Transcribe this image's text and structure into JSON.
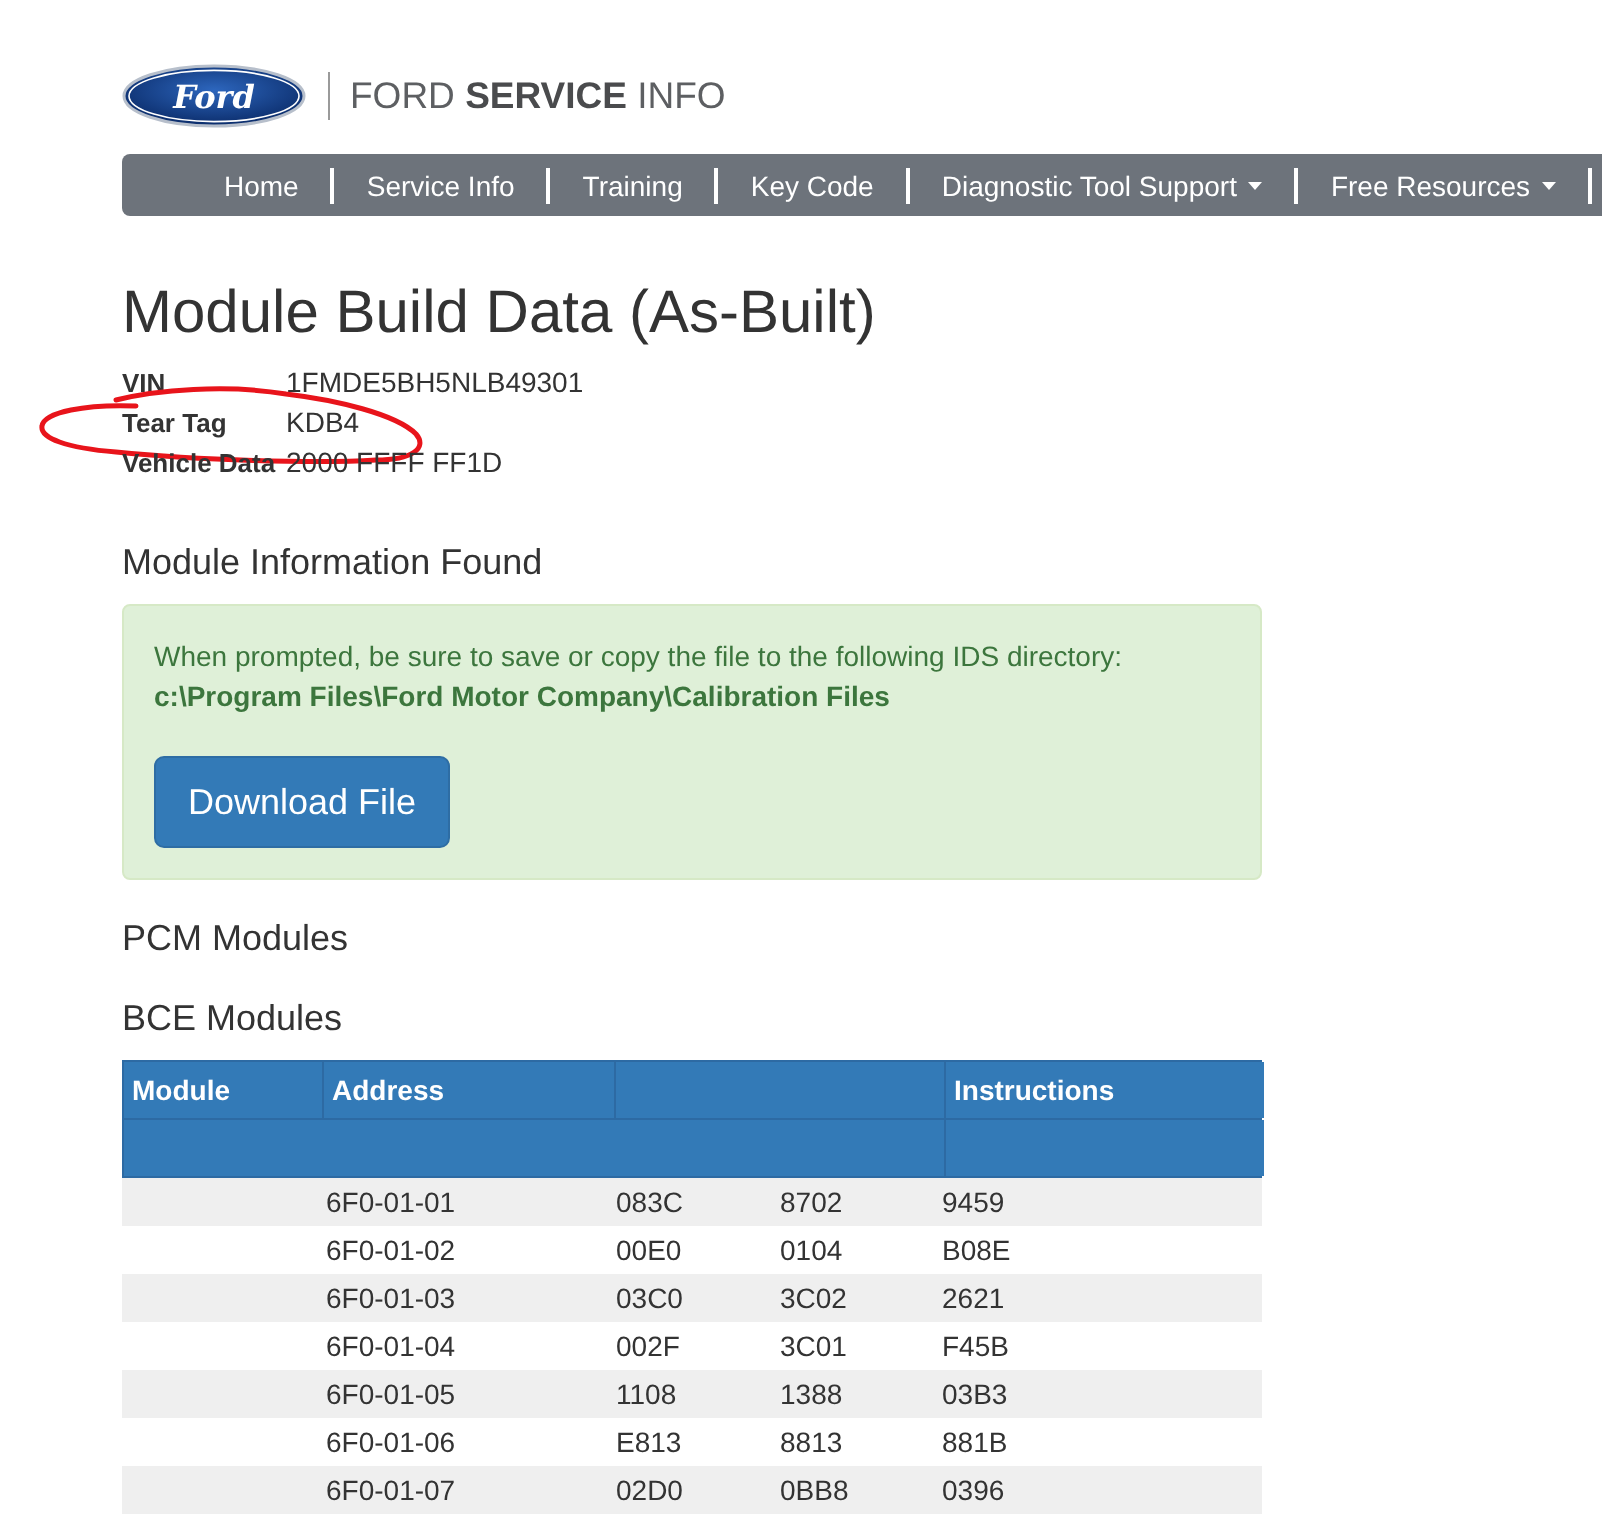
{
  "header": {
    "logo": {
      "text": "Ford"
    },
    "site_name": "FORD **SERVICE** INFO"
  },
  "nav": [
    {
      "label": "Home",
      "dropdown": false
    },
    {
      "label": "Service Info",
      "dropdown": false
    },
    {
      "label": "Training",
      "dropdown": false
    },
    {
      "label": "Key Code",
      "dropdown": false
    },
    {
      "label": "Diagnostic Tool Support",
      "dropdown": true
    },
    {
      "label": "Free Resources",
      "dropdown": true
    }
  ],
  "title": "Module Build Data (As-Built)",
  "vehicle_info": [
    {
      "label": "VIN",
      "value": "1FMDE5BH5NLB49301",
      "circled": false
    },
    {
      "label": "Tear Tag",
      "value": "KDB4",
      "circled": true
    },
    {
      "label": "Vehicle Data",
      "value": "2000 FFFF FF1D",
      "circled": false
    }
  ],
  "module_info": {
    "heading": "Module Information Found",
    "alert": {
      "message": "When prompted, be sure to save or copy the file to the following IDS directory:",
      "path": "c:\\Program Files\\Ford Motor Company\\Calibration Files",
      "button": "Download File"
    }
  },
  "pcm_modules": {
    "heading": "PCM Modules"
  },
  "bce_modules": {
    "heading": "BCE Modules",
    "table": {
      "columns": [
        {
          "kind": "label",
          "text": "Module"
        },
        {
          "kind": "label",
          "text": "Address"
        },
        {
          "kind": "blank"
        },
        {
          "kind": "label",
          "text": "Instructions"
        }
      ],
      "rows": [
        {
          "address": "6F0-01-01",
          "values": [
            "083C",
            "8702",
            "9459"
          ]
        },
        {
          "address": "6F0-01-02",
          "values": [
            "00E0",
            "0104",
            "B08E"
          ]
        },
        {
          "address": "6F0-01-03",
          "values": [
            "03C0",
            "3C02",
            "2621"
          ]
        },
        {
          "address": "6F0-01-04",
          "values": [
            "002F",
            "3C01",
            "F45B"
          ]
        },
        {
          "address": "6F0-01-05",
          "values": [
            "1108",
            "1388",
            "03B3"
          ]
        },
        {
          "address": "6F0-01-06",
          "values": [
            "E813",
            "8813",
            "881B"
          ]
        },
        {
          "address": "6F0-01-07",
          "values": [
            "02D0",
            "0BB8",
            "0396"
          ]
        }
      ]
    }
  }
}
